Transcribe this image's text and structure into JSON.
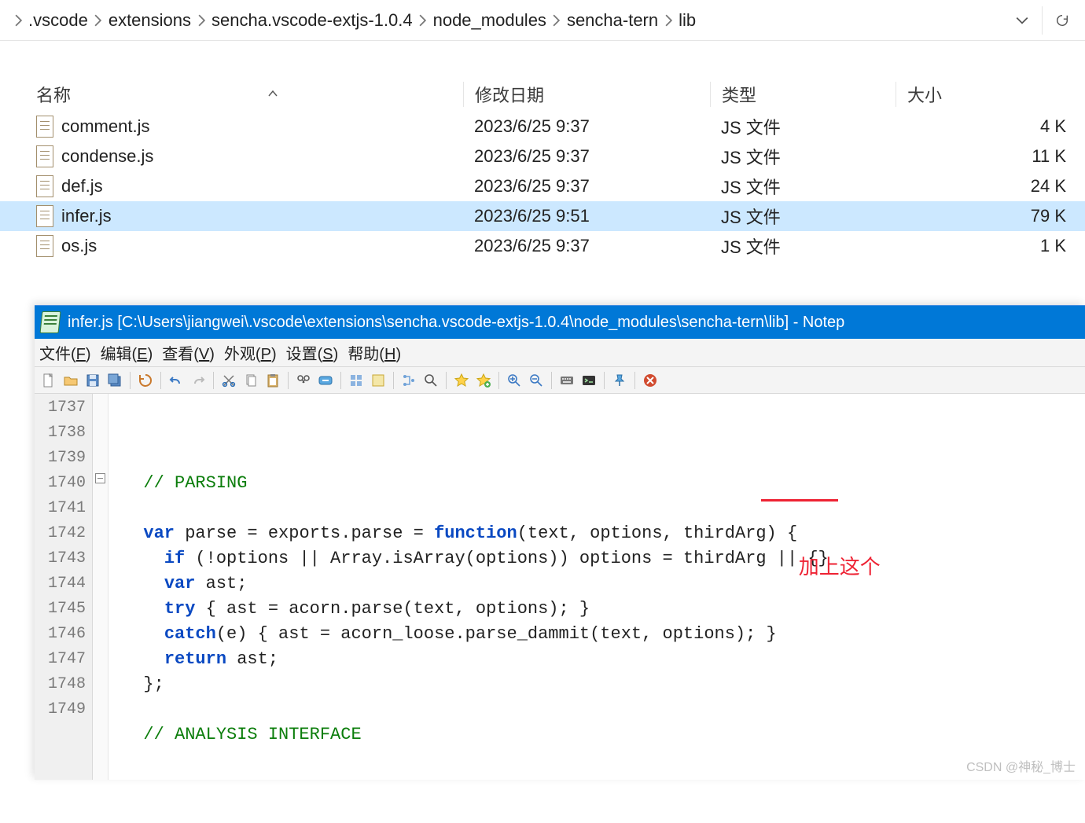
{
  "breadcrumb": [
    ".vscode",
    "extensions",
    "sencha.vscode-extjs-1.0.4",
    "node_modules",
    "sencha-tern",
    "lib"
  ],
  "columns": {
    "name": "名称",
    "date": "修改日期",
    "type": "类型",
    "size": "大小"
  },
  "files": [
    {
      "name": "comment.js",
      "date": "2023/6/25 9:37",
      "type": "JS 文件",
      "size": "4 K",
      "selected": false
    },
    {
      "name": "condense.js",
      "date": "2023/6/25 9:37",
      "type": "JS 文件",
      "size": "11 K",
      "selected": false
    },
    {
      "name": "def.js",
      "date": "2023/6/25 9:37",
      "type": "JS 文件",
      "size": "24 K",
      "selected": false
    },
    {
      "name": "infer.js",
      "date": "2023/6/25 9:51",
      "type": "JS 文件",
      "size": "79 K",
      "selected": true
    },
    {
      "name": "os.js",
      "date": "2023/6/25 9:37",
      "type": "JS 文件",
      "size": "1 K",
      "selected": false
    }
  ],
  "np": {
    "title": "infer.js [C:\\Users\\jiangwei\\.vscode\\extensions\\sencha.vscode-extjs-1.0.4\\node_modules\\sencha-tern\\lib] - Notep",
    "menu": [
      {
        "t": "文件",
        "u": "F"
      },
      {
        "t": "编辑",
        "u": "E"
      },
      {
        "t": "查看",
        "u": "V"
      },
      {
        "t": "外观",
        "u": "P"
      },
      {
        "t": "设置",
        "u": "S"
      },
      {
        "t": "帮助",
        "u": "H"
      }
    ],
    "lines": [
      1737,
      1738,
      1739,
      1740,
      1741,
      1742,
      1743,
      1744,
      1745,
      1746,
      1747,
      1748,
      1749
    ],
    "code": [
      "",
      "  // PARSING",
      "",
      "  var parse = exports.parse = function(text, options, thirdArg) {",
      "    if (!options || Array.isArray(options)) options = thirdArg || {}",
      "    var ast;",
      "    try { ast = acorn.parse(text, options); }",
      "    catch(e) { ast = acorn_loose.parse_dammit(text, options); }",
      "    return ast;",
      "  };",
      "",
      "  // ANALYSIS INTERFACE",
      ""
    ],
    "annotation": "加上这个"
  },
  "watermark": "CSDN @神秘_博士"
}
